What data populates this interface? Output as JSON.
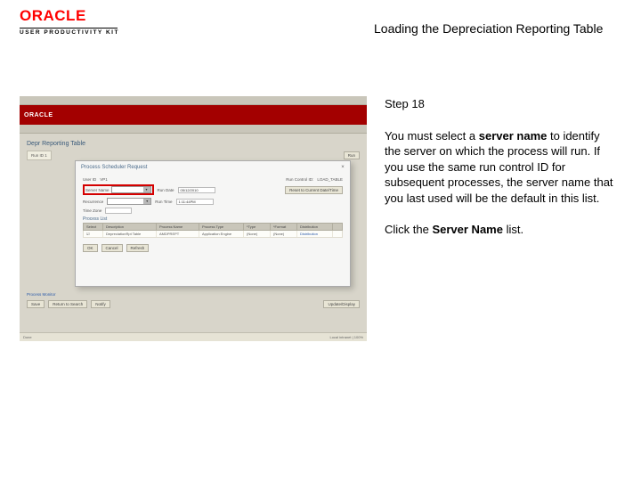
{
  "logo": {
    "brand": "ORACLE",
    "product": "USER PRODUCTIVITY KIT"
  },
  "title": "Loading the Depreciation Reporting Table",
  "instructions": {
    "step_label": "Step 18",
    "body_text_pre": "You must select a ",
    "body_bold": "server name",
    "body_text_post": " to identify the server on which the process will run. If you use the same run control ID for subsequent processes, the server name that you last used will be the default in this list.",
    "click_pre": "Click the ",
    "click_bold": "Server Name",
    "click_post": " list."
  },
  "screenshot": {
    "header_logo": "ORACLE",
    "page_title": "Depr Reporting Table",
    "tabs_text": "  ",
    "runid_left": "Run ID  1",
    "run_btn": "Run",
    "modal": {
      "title": "Process Scheduler Request",
      "close": "×",
      "userid_label": "User ID",
      "userid_value": "VP1",
      "runcontrol_label": "Run Control ID:",
      "runcontrol_value": "LOAD_TABLE",
      "servername_label": "Server Name",
      "rundate_label": "Run Date",
      "rundate_value": "05/12/2010",
      "recurrence_label": "Recurrence",
      "runtime_label": "Run Time",
      "runtime_value": "1:11:44PM",
      "reset_btn": "Reset to Current Date/Time",
      "timezone_label": "Time Zone",
      "grid_title": "Process List",
      "grid_headers": [
        "Select",
        "Description",
        "Process Name",
        "Process Type",
        "*Type",
        "*Format",
        "Distribution"
      ],
      "grid_row": [
        "☑",
        "DepreciationRpt Table",
        "AMDPREPT",
        "Application Engine",
        "(None)",
        "(None)",
        "Distribution"
      ],
      "ok": "OK",
      "cancel": "Cancel",
      "refresh": "Refresh"
    },
    "below": {
      "notify": "Notify",
      "process_monitor_link": "Process Monitor",
      "save": "Save",
      "return": "Return to Search",
      "update": "Update/Display"
    },
    "status": {
      "left": "Done",
      "right1": "Local intranet",
      "right2": "100%"
    }
  }
}
